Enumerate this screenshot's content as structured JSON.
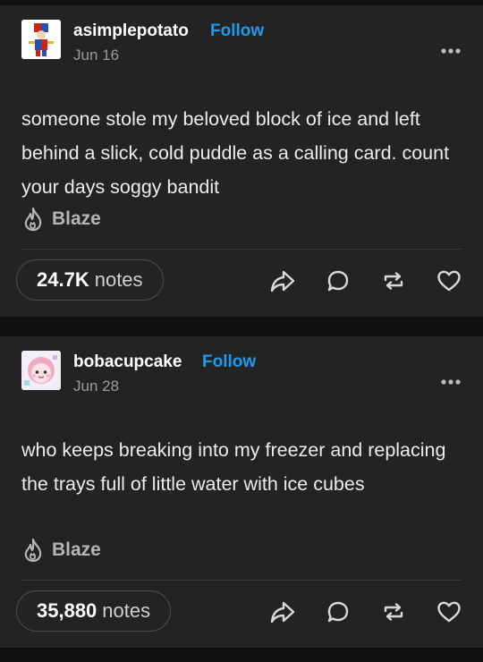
{
  "posts": [
    {
      "username": "asimplepotato",
      "follow_label": "Follow",
      "date": "Jun 16",
      "text": "someone stole my beloved block of ice and left behind a slick, cold puddle as a calling card. count your days soggy bandit",
      "blaze_label": "Blaze",
      "notes_count": "24.7K",
      "notes_label": "notes"
    },
    {
      "username": "bobacupcake",
      "follow_label": "Follow",
      "date": "Jun 28",
      "text": "who keeps breaking into my freezer and replacing the trays full of little water with ice cubes",
      "blaze_label": "Blaze",
      "notes_count": "35,880",
      "notes_label": "notes"
    }
  ],
  "icons": {
    "more": "more-options-icon",
    "blaze": "flame-icon",
    "share": "share-icon",
    "reply": "reply-icon",
    "reblog": "reblog-icon",
    "like": "heart-icon"
  },
  "colors": {
    "background": "#101010",
    "card": "#232323",
    "follow_accent": "#1e9bf0"
  }
}
